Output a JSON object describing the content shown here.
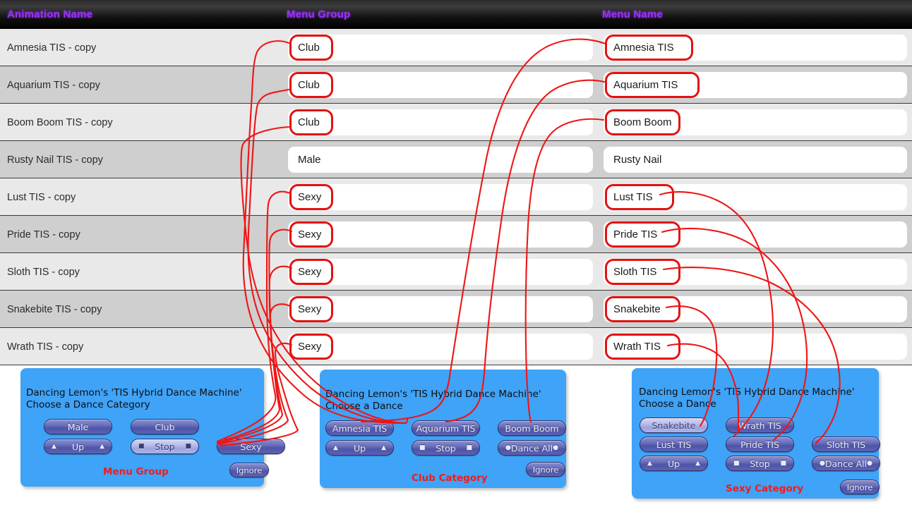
{
  "table": {
    "headers": {
      "animation_name": "Animation Name",
      "menu_group": "Menu Group",
      "menu_name": "Menu Name"
    },
    "header_text_color": "#9B30FF",
    "rows": [
      {
        "animation_name": "Amnesia TIS - copy",
        "menu_group": "Club",
        "menu_name": "Amnesia TIS",
        "group_circled": true,
        "name_circled": true
      },
      {
        "animation_name": "Aquarium TIS - copy",
        "menu_group": "Club",
        "menu_name": "Aquarium TIS",
        "group_circled": true,
        "name_circled": true
      },
      {
        "animation_name": "Boom Boom TIS - copy",
        "menu_group": "Club",
        "menu_name": "Boom Boom",
        "group_circled": true,
        "name_circled": true
      },
      {
        "animation_name": "Rusty Nail TIS - copy",
        "menu_group": "Male",
        "menu_name": "Rusty Nail",
        "group_circled": false,
        "name_circled": false
      },
      {
        "animation_name": "Lust TIS - copy",
        "menu_group": "Sexy",
        "menu_name": "Lust TIS",
        "group_circled": true,
        "name_circled": true
      },
      {
        "animation_name": "Pride TIS - copy",
        "menu_group": "Sexy",
        "menu_name": "Pride TIS",
        "group_circled": true,
        "name_circled": true
      },
      {
        "animation_name": "Sloth TIS - copy",
        "menu_group": "Sexy",
        "menu_name": "Sloth TIS",
        "group_circled": true,
        "name_circled": true
      },
      {
        "animation_name": "Snakebite TIS - copy",
        "menu_group": "Sexy",
        "menu_name": "Snakebite",
        "group_circled": true,
        "name_circled": true
      },
      {
        "animation_name": "Wrath TIS - copy",
        "menu_group": "Sexy",
        "menu_name": "Wrath TIS",
        "group_circled": true,
        "name_circled": true
      }
    ]
  },
  "dialogs": [
    {
      "id": "menu-group",
      "title": "Dancing Lemon's 'TIS Hybrid Dance Machine'\nChoose a Dance Category",
      "caption": "Menu Group",
      "ignore_label": "Ignore",
      "buttons": [
        {
          "label": "Male",
          "highlight": false,
          "deco": "none"
        },
        {
          "label": "Club",
          "highlight": false,
          "deco": "none"
        },
        {
          "label": "",
          "highlight": false,
          "deco": "none",
          "blank": true
        },
        {
          "label": "Up",
          "highlight": false,
          "deco": "triangle"
        },
        {
          "label": "Stop",
          "highlight": true,
          "deco": "square"
        },
        {
          "label": "Sexy",
          "highlight": false,
          "deco": "none"
        }
      ]
    },
    {
      "id": "club-category",
      "title": "Dancing Lemon's 'TIS Hybrid Dance Machine'\nChoose a Dance",
      "caption": "Club Category",
      "ignore_label": "Ignore",
      "buttons": [
        {
          "label": "Amnesia TIS",
          "highlight": false,
          "deco": "none"
        },
        {
          "label": "Aquarium TIS",
          "highlight": false,
          "deco": "none"
        },
        {
          "label": "Boom Boom",
          "highlight": false,
          "deco": "none"
        },
        {
          "label": "Up",
          "highlight": false,
          "deco": "triangle"
        },
        {
          "label": "Stop",
          "highlight": false,
          "deco": "square"
        },
        {
          "label": "Dance All",
          "highlight": false,
          "deco": "dot"
        }
      ]
    },
    {
      "id": "sexy-category",
      "title": "Dancing Lemon's 'TIS Hybrid Dance Machine'\nChoose a Dance",
      "caption": "Sexy Category",
      "ignore_label": "Ignore",
      "buttons": [
        {
          "label": "Snakebite",
          "highlight": true,
          "deco": "none"
        },
        {
          "label": "Wrath TIS",
          "highlight": false,
          "deco": "none"
        },
        {
          "label": "",
          "highlight": false,
          "deco": "none",
          "blank": true
        },
        {
          "label": "Lust TIS",
          "highlight": false,
          "deco": "none"
        },
        {
          "label": "Pride TIS",
          "highlight": false,
          "deco": "none"
        },
        {
          "label": "Sloth TIS",
          "highlight": false,
          "deco": "none"
        },
        {
          "label": "Up",
          "highlight": false,
          "deco": "triangle"
        },
        {
          "label": "Stop",
          "highlight": false,
          "deco": "square"
        },
        {
          "label": "Dance All",
          "highlight": false,
          "deco": "dot"
        }
      ]
    }
  ],
  "annotation": {
    "color": "#ef1515",
    "description": "Red hand-drawn lines link circled table values to matching dialog buttons"
  }
}
